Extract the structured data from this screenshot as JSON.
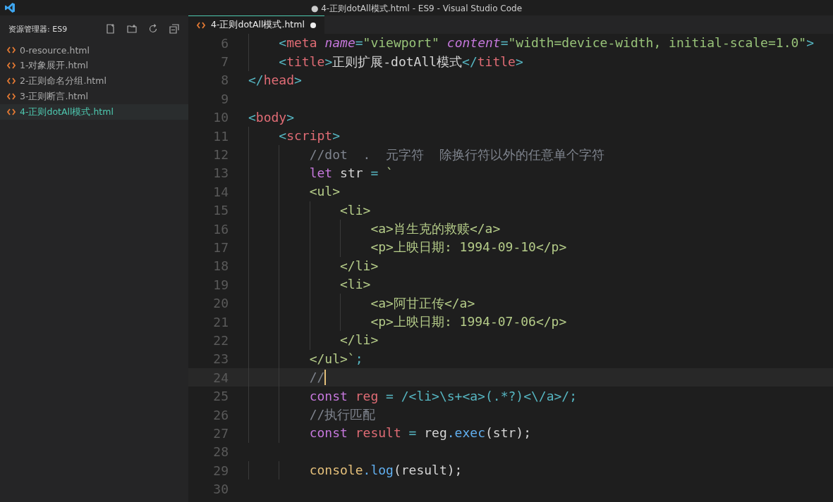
{
  "window": {
    "title": "● 4-正则dotAll模式.html - ES9 - Visual Studio Code"
  },
  "sidebar": {
    "title": "资源管理器: ES9",
    "files": [
      {
        "name": "0-resource.html",
        "selected": false
      },
      {
        "name": "1-对象展开.html",
        "selected": false
      },
      {
        "name": "2-正则命名分组.html",
        "selected": false
      },
      {
        "name": "3-正则断言.html",
        "selected": false
      },
      {
        "name": "4-正则dotAll模式.html",
        "selected": true
      }
    ]
  },
  "tabs": [
    {
      "label": "4-正则dotAll模式.html",
      "selected": true,
      "modified": true
    }
  ],
  "editor": {
    "lines": [
      {
        "number": "6",
        "current": false,
        "tokens": [
          {
            "kind": "punct",
            "text": "    <"
          },
          {
            "kind": "tag",
            "text": "meta"
          },
          {
            "kind": "attr",
            "text": " name"
          },
          {
            "kind": "punct",
            "text": "="
          },
          {
            "kind": "string",
            "text": "\"viewport\""
          },
          {
            "kind": "attr",
            "text": " content"
          },
          {
            "kind": "punct",
            "text": "="
          },
          {
            "kind": "string",
            "text": "\"width=device-width, initial-scale=1.0\""
          },
          {
            "kind": "punct",
            "text": ">"
          }
        ]
      },
      {
        "number": "7",
        "current": false,
        "tokens": [
          {
            "kind": "punct",
            "text": "    <"
          },
          {
            "kind": "tag",
            "text": "title"
          },
          {
            "kind": "punct",
            "text": ">"
          },
          {
            "kind": "plain",
            "text": "正则扩展-dotAll模式"
          },
          {
            "kind": "punct",
            "text": "</"
          },
          {
            "kind": "tag",
            "text": "title"
          },
          {
            "kind": "punct",
            "text": ">"
          }
        ]
      },
      {
        "number": "8",
        "current": false,
        "tokens": [
          {
            "kind": "punct",
            "text": "</"
          },
          {
            "kind": "tag",
            "text": "head"
          },
          {
            "kind": "punct",
            "text": ">"
          }
        ]
      },
      {
        "number": "9",
        "current": false
      },
      {
        "number": "10",
        "current": false,
        "tokens": [
          {
            "kind": "punct",
            "text": "<"
          },
          {
            "kind": "tag",
            "text": "body"
          },
          {
            "kind": "punct",
            "text": ">"
          }
        ]
      },
      {
        "number": "11",
        "current": false,
        "tokens": [
          {
            "kind": "punct",
            "text": "    <"
          },
          {
            "kind": "tag",
            "text": "script"
          },
          {
            "kind": "punct",
            "text": ">"
          }
        ]
      },
      {
        "number": "12",
        "current": false,
        "tokens": [
          {
            "kind": "comment",
            "text": "        //dot  .  元字符  除换行符以外的任意单个字符"
          }
        ]
      },
      {
        "number": "13",
        "current": false,
        "tokens": [
          {
            "kind": "keyword",
            "text": "        let"
          },
          {
            "kind": "plain",
            "text": " str "
          },
          {
            "kind": "op",
            "text": "="
          },
          {
            "kind": "template",
            "text": " `"
          }
        ]
      },
      {
        "number": "14",
        "current": false,
        "tokens": [
          {
            "kind": "template",
            "text": "        <ul>"
          }
        ]
      },
      {
        "number": "15",
        "current": false,
        "tokens": [
          {
            "kind": "template",
            "text": "            <li>"
          }
        ]
      },
      {
        "number": "16",
        "current": false,
        "tokens": [
          {
            "kind": "template",
            "text": "                <a>肖生克的救赎</a>"
          }
        ]
      },
      {
        "number": "17",
        "current": false,
        "tokens": [
          {
            "kind": "template",
            "text": "                <p>上映日期: 1994-09-10</p>"
          }
        ]
      },
      {
        "number": "18",
        "current": false,
        "tokens": [
          {
            "kind": "template",
            "text": "            </li>"
          }
        ]
      },
      {
        "number": "19",
        "current": false,
        "tokens": [
          {
            "kind": "template",
            "text": "            <li>"
          }
        ]
      },
      {
        "number": "20",
        "current": false,
        "tokens": [
          {
            "kind": "template",
            "text": "                <a>阿甘正传</a>"
          }
        ]
      },
      {
        "number": "21",
        "current": false,
        "tokens": [
          {
            "kind": "template",
            "text": "                <p>上映日期: 1994-07-06</p>"
          }
        ]
      },
      {
        "number": "22",
        "current": false,
        "tokens": [
          {
            "kind": "template",
            "text": "            </li>"
          }
        ]
      },
      {
        "number": "23",
        "current": false,
        "tokens": [
          {
            "kind": "template",
            "text": "        </ul>`"
          },
          {
            "kind": "punct",
            "text": ";"
          }
        ]
      },
      {
        "number": "24",
        "current": true,
        "tokens": [
          {
            "kind": "comment",
            "text": "        //"
          }
        ]
      },
      {
        "number": "25",
        "current": false,
        "tokens": [
          {
            "kind": "keyword",
            "text": "        const"
          },
          {
            "kind": "variable",
            "text": " reg "
          },
          {
            "kind": "op",
            "text": "= "
          },
          {
            "kind": "regex",
            "text": "/<li>\\s+<a>(.*?)<\\/a>/"
          },
          {
            "kind": "punct",
            "text": ";"
          }
        ]
      },
      {
        "number": "26",
        "current": false,
        "tokens": [
          {
            "kind": "comment",
            "text": "        //执行匹配"
          }
        ]
      },
      {
        "number": "27",
        "current": false,
        "tokens": [
          {
            "kind": "keyword",
            "text": "        const"
          },
          {
            "kind": "variable",
            "text": " result "
          },
          {
            "kind": "op",
            "text": "="
          },
          {
            "kind": "plain",
            "text": " reg"
          },
          {
            "kind": "method",
            "text": ".exec"
          },
          {
            "kind": "plain",
            "text": "(str);"
          }
        ]
      },
      {
        "number": "28",
        "current": false
      },
      {
        "number": "29",
        "current": false,
        "tokens": [
          {
            "kind": "console",
            "text": "        console"
          },
          {
            "kind": "method",
            "text": ".log"
          },
          {
            "kind": "plain",
            "text": "(result);"
          }
        ]
      },
      {
        "number": "30",
        "current": false
      }
    ]
  }
}
